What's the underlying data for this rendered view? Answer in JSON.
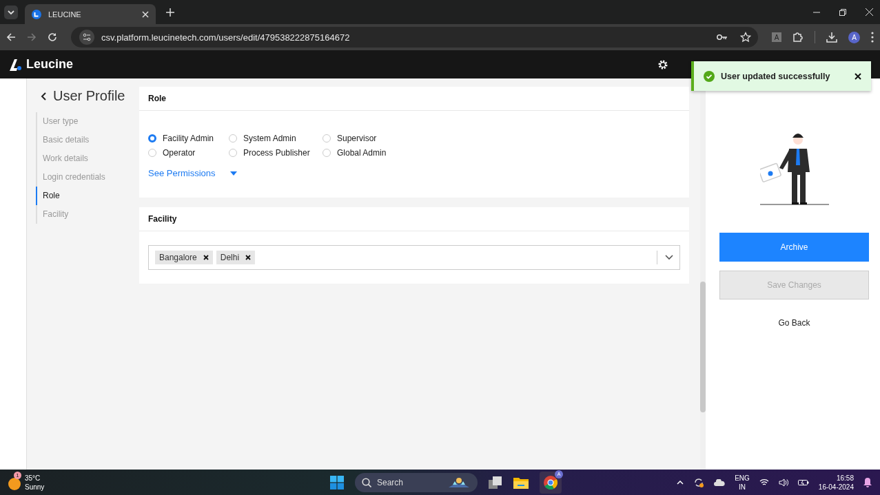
{
  "browser": {
    "tab_title": "LEUCINE",
    "url": "csv.platform.leucinetech.com/users/edit/479538222875164672",
    "extension_label": "A",
    "profile_initial": "A"
  },
  "app": {
    "brand": "Leucine"
  },
  "toast": {
    "message": "User updated successfully"
  },
  "page": {
    "title": "User Profile",
    "nav": [
      {
        "label": "User type",
        "selected": false
      },
      {
        "label": "Basic details",
        "selected": false
      },
      {
        "label": "Work details",
        "selected": false
      },
      {
        "label": "Login credentials",
        "selected": false
      },
      {
        "label": "Role",
        "selected": true
      },
      {
        "label": "Facility",
        "selected": false
      }
    ]
  },
  "role_card": {
    "title": "Role",
    "options": [
      {
        "label": "Facility Admin",
        "selected": true
      },
      {
        "label": "System Admin",
        "selected": false
      },
      {
        "label": "Supervisor",
        "selected": false
      },
      {
        "label": "Operator",
        "selected": false
      },
      {
        "label": "Process Publisher",
        "selected": false
      },
      {
        "label": "Global Admin",
        "selected": false
      }
    ],
    "permissions_link": "See Permissions"
  },
  "facility_card": {
    "title": "Facility",
    "tags": [
      "Bangalore",
      "Delhi"
    ]
  },
  "actions": {
    "archive": "Archive",
    "save_changes": {
      "label": "Save Changes",
      "disabled": true
    },
    "go_back": "Go Back"
  },
  "taskbar": {
    "weather": {
      "temperature": "35°C",
      "condition": "Sunny",
      "badge": "1"
    },
    "search": "Search",
    "profile_badge": "A",
    "language": "ENG",
    "region": "IN",
    "time": "16:58",
    "date": "16-04-2024"
  }
}
